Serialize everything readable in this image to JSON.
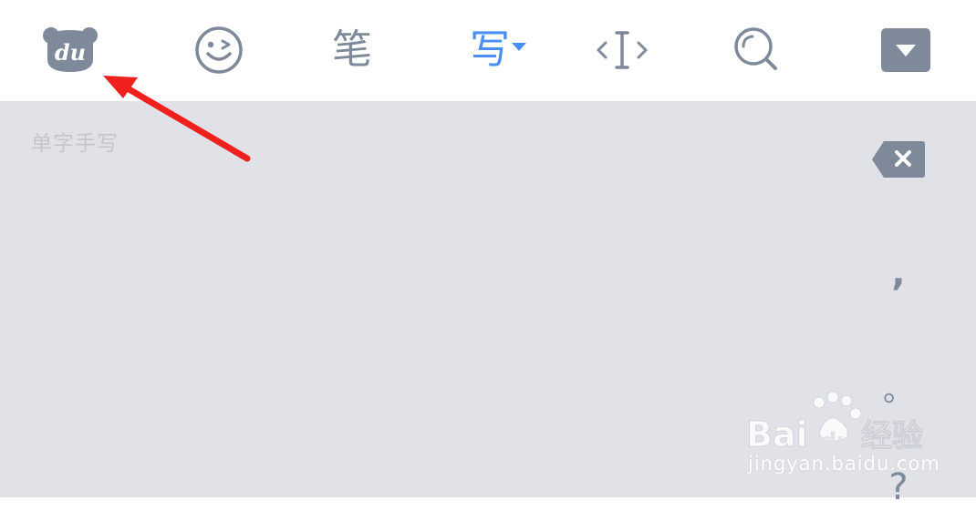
{
  "toolbar": {
    "logo": {
      "icon": "baidu-du-logo-icon",
      "text": "du"
    },
    "emoji": {
      "icon": "wink-face-icon"
    },
    "pen": {
      "label": "笔"
    },
    "write": {
      "label": "写",
      "icon": "caret-down-icon",
      "active": true
    },
    "cursor": {
      "label": "‹I›",
      "icon": "cursor-move-icon"
    },
    "search": {
      "icon": "search-icon"
    },
    "collapse": {
      "icon": "collapse-keyboard-icon"
    }
  },
  "panel": {
    "hint": "单字手写",
    "side_keys": [
      {
        "name": "backspace",
        "icon": "backspace-icon"
      },
      {
        "name": "comma",
        "label": ","
      },
      {
        "name": "period",
        "label": "。"
      },
      {
        "name": "question",
        "label": "?"
      }
    ]
  },
  "annotation": {
    "icon": "red-arrow-icon",
    "color": "#f0201e"
  },
  "watermark": {
    "brand": "Bai",
    "brand2": "du",
    "suffix": "经验",
    "url": "jingyan.baidu.com"
  },
  "colors": {
    "icon_gray": "#7e8a99",
    "accent_blue": "#4a8ff5",
    "panel_bg": "#e0e2e7"
  }
}
